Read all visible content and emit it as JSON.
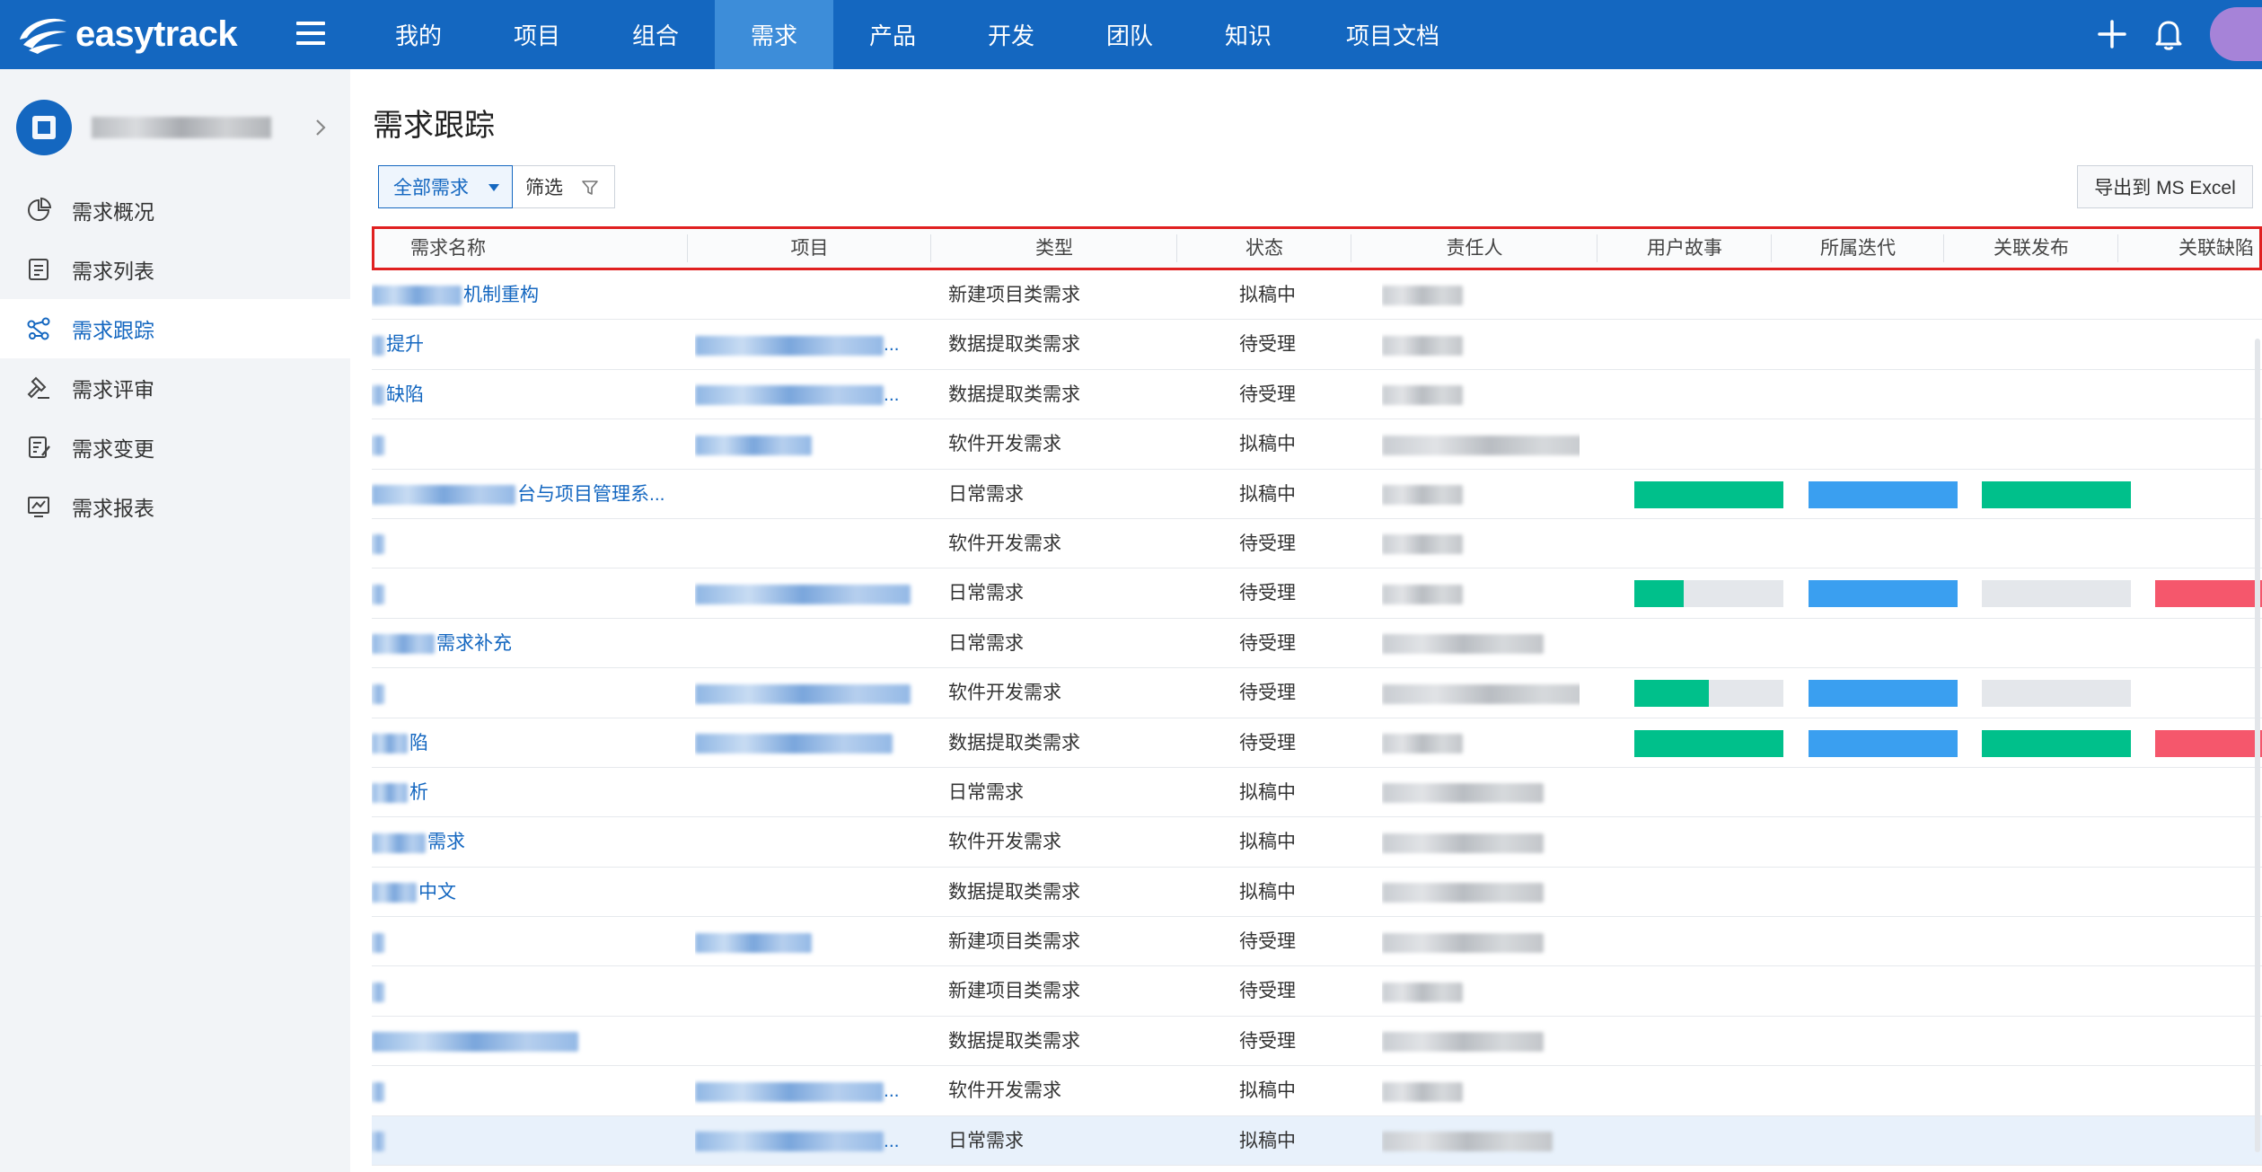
{
  "app": {
    "logo_text": "easytrack"
  },
  "nav": {
    "items": [
      "我的",
      "项目",
      "组合",
      "需求",
      "产品",
      "开发",
      "团队",
      "知识",
      "项目文档"
    ],
    "active_index": 3
  },
  "sidebar": {
    "menu": [
      {
        "label": "需求概况",
        "icon": "pie-chart-icon"
      },
      {
        "label": "需求列表",
        "icon": "list-icon"
      },
      {
        "label": "需求跟踪",
        "icon": "share-nodes-icon"
      },
      {
        "label": "需求评审",
        "icon": "gavel-icon"
      },
      {
        "label": "需求变更",
        "icon": "edit-document-icon"
      },
      {
        "label": "需求报表",
        "icon": "line-chart-icon"
      }
    ],
    "active_index": 2
  },
  "page": {
    "title": "需求跟踪",
    "filter_all_label": "全部需求",
    "filter_label": "筛选",
    "export_label": "导出到 MS Excel"
  },
  "table": {
    "columns": [
      "需求名称",
      "项目",
      "类型",
      "状态",
      "责任人",
      "用户故事",
      "所属迭代",
      "关联发布",
      "关联缺陷"
    ],
    "rows": [
      {
        "name": "机制重构",
        "project": "",
        "type": "新建项目类需求",
        "status": "拟稿中"
      },
      {
        "name": "提升",
        "project": "...",
        "type": "数据提取类需求",
        "status": "待受理"
      },
      {
        "name": "缺陷",
        "project": "...",
        "type": "数据提取类需求",
        "status": "待受理"
      },
      {
        "name": "",
        "project": "",
        "type": "软件开发需求",
        "status": "拟稿中"
      },
      {
        "name": "台与项目管理系...",
        "project": "",
        "type": "日常需求",
        "status": "拟稿中",
        "progress": {
          "user_story": 1.0,
          "iteration": 1.0,
          "release": 1.0
        }
      },
      {
        "name": "",
        "project": "",
        "type": "软件开发需求",
        "status": "待受理"
      },
      {
        "name": "",
        "project": "",
        "type": "日常需求",
        "status": "待受理",
        "progress": {
          "user_story": 0.33,
          "iteration": 1.0,
          "release": 0.0,
          "defect": 1.0
        }
      },
      {
        "name": "需求补充",
        "project": "",
        "type": "日常需求",
        "status": "待受理"
      },
      {
        "name": "",
        "project": "",
        "type": "软件开发需求",
        "status": "待受理",
        "progress": {
          "user_story": 0.5,
          "iteration": 1.0,
          "release": 0.0
        }
      },
      {
        "name": "陷",
        "project": "",
        "type": "数据提取类需求",
        "status": "待受理",
        "progress": {
          "user_story": 1.0,
          "iteration": 1.0,
          "release": 1.0,
          "defect": 1.0
        }
      },
      {
        "name": "析",
        "project": "",
        "type": "日常需求",
        "status": "拟稿中"
      },
      {
        "name": "需求",
        "project": "",
        "type": "软件开发需求",
        "status": "拟稿中"
      },
      {
        "name": "中文",
        "project": "",
        "type": "数据提取类需求",
        "status": "拟稿中"
      },
      {
        "name": "",
        "project": "",
        "type": "新建项目类需求",
        "status": "待受理"
      },
      {
        "name": "",
        "project": "",
        "type": "新建项目类需求",
        "status": "待受理"
      },
      {
        "name": "",
        "project": "",
        "type": "数据提取类需求",
        "status": "待受理"
      },
      {
        "name": "",
        "project": "...",
        "type": "软件开发需求",
        "status": "拟稿中"
      },
      {
        "name": "",
        "project": "...",
        "type": "日常需求",
        "status": "拟稿中"
      }
    ]
  },
  "colors": {
    "brand": "#1467c0",
    "nav_active": "#3d8dd9",
    "progress_green": "#00c08b",
    "progress_blue": "#3a9ff0",
    "progress_red": "#f5576c",
    "progress_empty": "#e4e7eb",
    "header_outline": "#e02020"
  }
}
